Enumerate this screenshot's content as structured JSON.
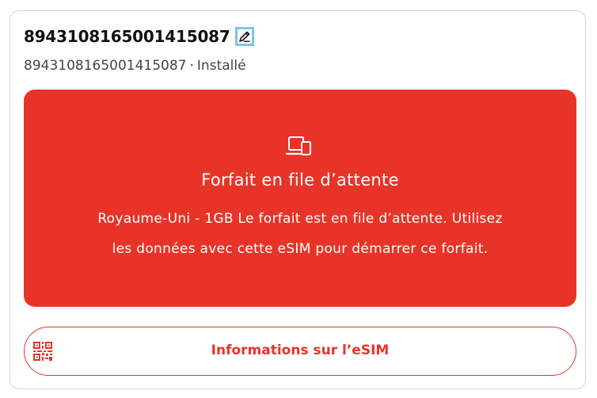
{
  "esim": {
    "name": "8943108165001415087",
    "iccid": "8943108165001415087",
    "separator": "·",
    "status": "Installé"
  },
  "banner": {
    "icon": "devices-icon",
    "title": "Forfait en file d’attente",
    "line1": "Royaume-Uni - 1GB Le forfait est en file d’attente. Utilisez",
    "line2": "les données avec cette eSIM pour démarrer ce forfait.",
    "color": "#e83428"
  },
  "info_button": {
    "icon": "qr-code-icon",
    "label": "Informations sur l’eSIM"
  },
  "colors": {
    "accent": "#e83428",
    "focus_outline": "#7cc6ee"
  }
}
